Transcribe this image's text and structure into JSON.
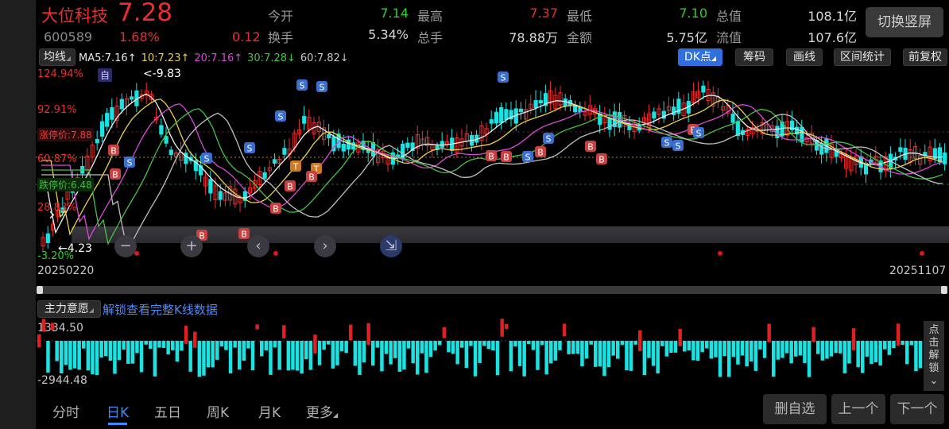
{
  "stock": {
    "name": "大位科技",
    "price": "7.28",
    "code": "600589",
    "change_pct": "1.68%",
    "change_amt": "0.12"
  },
  "quote": {
    "open_label": "今开",
    "open": "7.14",
    "high_label": "最高",
    "high": "7.37",
    "low_label": "最低",
    "low": "7.10",
    "cap_label": "总值",
    "cap": "108.1亿",
    "turnover_label": "换手",
    "turnover": "5.34%",
    "volume_label": "总手",
    "volume": "78.88万",
    "amount_label": "金额",
    "amount": "5.75亿",
    "float_label": "流值",
    "float_cap": "107.6亿"
  },
  "switch_button": "切换竖屏",
  "toolbar": {
    "indicator": "均线",
    "ma5": "MA5:7.16↑",
    "ma10": "10:7.23↑",
    "ma20": "20:7.16↑",
    "ma30": "30:7.28↓",
    "ma60": "60:7.82↓",
    "dk": "DK点",
    "chips": "筹码",
    "draw": "画线",
    "range": "区间统计",
    "adjust": "前复权"
  },
  "axis": {
    "y1": "124.94%",
    "y2": "92.91%",
    "y3": "60.87%",
    "y4": "28.83%",
    "y5": "-3.20%",
    "limit_up": "涨停价:7.88",
    "limit_down": "跌停价:6.48",
    "high_marker": "<-9.83",
    "low_marker": "←4.23",
    "self_tag": "自",
    "date_start": "20250220",
    "date_end": "20251107"
  },
  "sub_chart": {
    "indicator": "主力意愿",
    "unlock_link": "解锁查看完整K线数据",
    "top_value": "1334.50",
    "bottom_value": "-2944.48",
    "side_button": "点击解锁"
  },
  "bottom_nav": {
    "tabs": [
      "分时",
      "日K",
      "五日",
      "周K",
      "月K",
      "更多"
    ],
    "active": "日K",
    "delete_btn": "删自选",
    "prev_btn": "上一个",
    "next_btn": "下一个"
  },
  "colors": {
    "up": "#f02c2c",
    "down": "#2bd02b",
    "accent": "#2f6fe0",
    "cyan_bar": "#19e3e3"
  }
}
